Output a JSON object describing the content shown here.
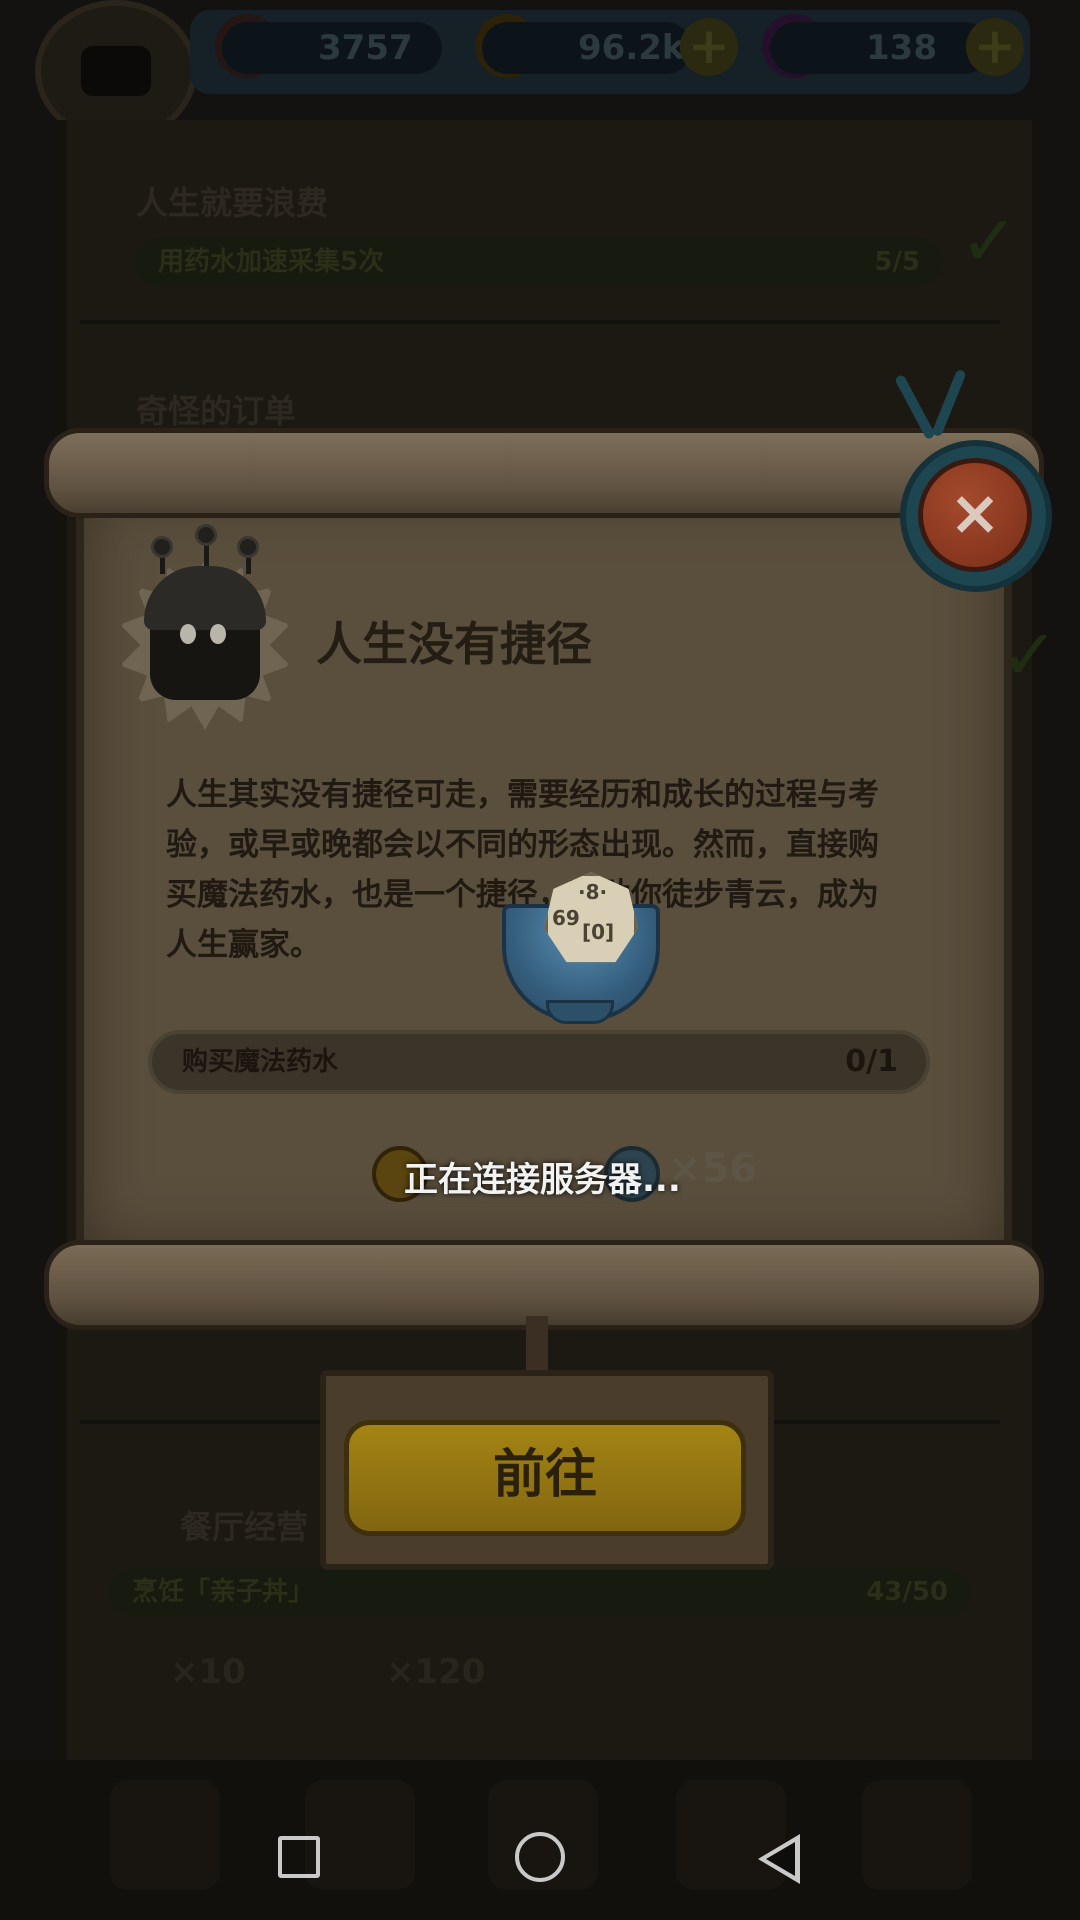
{
  "hud": {
    "stat_1": "3757",
    "gold": "96.2k",
    "potions": "138",
    "plus_symbol": "+"
  },
  "background_tasks": [
    {
      "title": "人生就要浪费",
      "progress_label": "用药水加速采集5次",
      "progress": "5/5"
    },
    {
      "title": "奇怪的订单"
    },
    {
      "title": "餐厅经营",
      "progress_label": "烹饪「亲子丼」",
      "progress": "43/50",
      "reward_1": "×10",
      "reward_2": "×120"
    }
  ],
  "dialog": {
    "title": "人生没有捷径",
    "body": "人生其实没有捷径可走，需要经历和成长的过程与考验，或早或晚都会以不同的形态出现。然而，直接购买魔法药水，也是一个捷径，帮助你徒步青云，成为人生赢家。",
    "requirement_label": "购买魔法药水",
    "requirement_count": "0/1",
    "reward_multiplier": "×56",
    "close_symbol": "×",
    "go_button": "前往"
  },
  "loading": {
    "text": "正在连接服务器..."
  },
  "colors": {
    "go_button": "#a48414",
    "close_button": "#a44a2c",
    "scroll_paper": "#5a4f3d"
  }
}
